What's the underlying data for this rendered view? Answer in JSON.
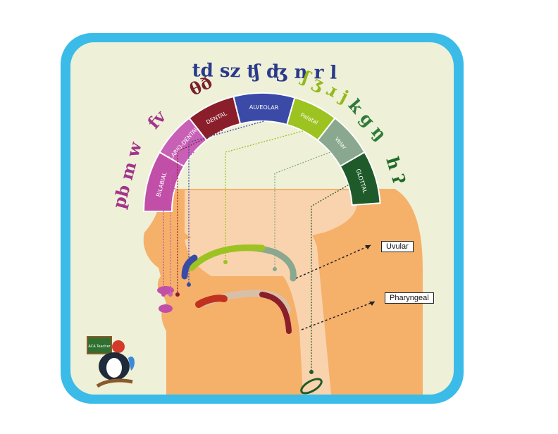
{
  "places": [
    {
      "label": "BILABIAL",
      "color": "#c14fa8",
      "sounds": "pb m w",
      "sound_color": "#a2338a"
    },
    {
      "label": "LABIO-DENTAL",
      "color": "#c860b6",
      "sounds": "fv",
      "sound_color": "#a2338a"
    },
    {
      "label": "DENTAL",
      "color": "#8a1e2a",
      "sounds": "θð",
      "sound_color": "#7b1f2c"
    },
    {
      "label": "ALVEOLAR",
      "color": "#3a4aa6",
      "sounds": "td sz ʧ ʤ n r l",
      "sound_color": "#2a3a8a"
    },
    {
      "label": "Palatal",
      "color": "#9cc31f",
      "sounds": "ʃ ʒ ɹ j",
      "sound_color": "#94b81b"
    },
    {
      "label": "Velar",
      "color": "#8aa88f",
      "sounds": "k g ŋ",
      "sound_color": "#2e7a3a"
    },
    {
      "label": "GLOTTAL",
      "color": "#1f5b2a",
      "sounds": "h ʔ",
      "sound_color": "#1f6a2a"
    }
  ],
  "labels": {
    "uvular": "Uvular",
    "pharyngeal": "Pharyngeal"
  },
  "logo": {
    "board_text": "ACA Teacher"
  },
  "colors": {
    "frame": "#3bbbe8",
    "background": "#eef0d8",
    "skin": "#f5b06a",
    "cavity": "#f9d3ad"
  }
}
